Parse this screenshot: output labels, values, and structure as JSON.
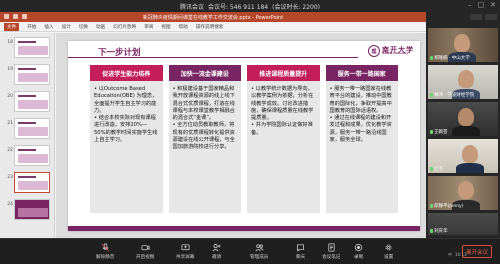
{
  "meeting": {
    "app_name": "腾讯会议",
    "meeting_id": "会议号: 546 911 184",
    "duration": "(会议时长: 2200)"
  },
  "ppt": {
    "window_title": "新冠肺炎疫情期间课堂在线教学工作交流会.pptx - PowerPoint",
    "menu": [
      "文件",
      "开始",
      "插入",
      "设计",
      "切换",
      "动画",
      "幻灯片放映",
      "审阅",
      "视图",
      "帮助",
      "操作说明搜索"
    ],
    "slide_numbers": [
      "18",
      "19",
      "20",
      "21",
      "22",
      "23",
      "24"
    ],
    "active_slide": "23"
  },
  "slide": {
    "title": "下一步计划",
    "logo_seal": "理",
    "logo_text": "南开大学",
    "logo_sub": "Nankai University",
    "columns": [
      {
        "heading": "促进学生能力培养",
        "body": "• 以Outcome Based Education(OBE) 为理念，全面提升学生自主学习的能力。\n• 结合本校实际对现有课程进行改造，安排20%—50%的教学时间实施学生线上自主学习。"
      },
      {
        "heading": "加快一流金课建设",
        "body": "• 积极建设基于国家精品和我开放课程资源的线上线下混合式优质课程，打造在线课程与本校课堂教学相融合的混合式“金课”。\n• 全方位动员教职教师，将现有的优质课程转化提供资源建设在线公开课程，与全国加旅游院校进行分享。"
      },
      {
        "heading": "推进课程质量提升",
        "body": "• 以教学统计数据为导向，以教学案例为依据，分析在线教学成效。讨论改进措施，确保课程质量在线教学提质量。\n• 并为学院国际认证做好准备。"
      },
      {
        "heading": "服务一带一路国家",
        "body": "• 服务一带一路国家在线教育平台的建设，推动中国教育的国际化，争取开提高中国教育的国际话语权。\n• 通过在线课程的建设和开发过程和成果，优化教学资源，服务一带一路沿线国家，服务全球。"
      }
    ]
  },
  "participants": [
    {
      "name": "郑隆楠 · 中山大学"
    },
    {
      "name": "林鸿 · 宁波财经学院"
    },
    {
      "name": "王颖芸"
    },
    {
      "name": "兰岑"
    },
    {
      "name": "邱静平(Jenny)"
    },
    {
      "name": "刘庆华"
    }
  ],
  "toolbar": {
    "items": [
      "解除静音",
      "开启视频",
      "共享屏幕",
      "邀请",
      "管理成员",
      "聊天",
      "会议笔记",
      "录制",
      "设置"
    ],
    "end_label": "离开会议"
  },
  "tray": {
    "lang": "中",
    "time": "16:13"
  }
}
